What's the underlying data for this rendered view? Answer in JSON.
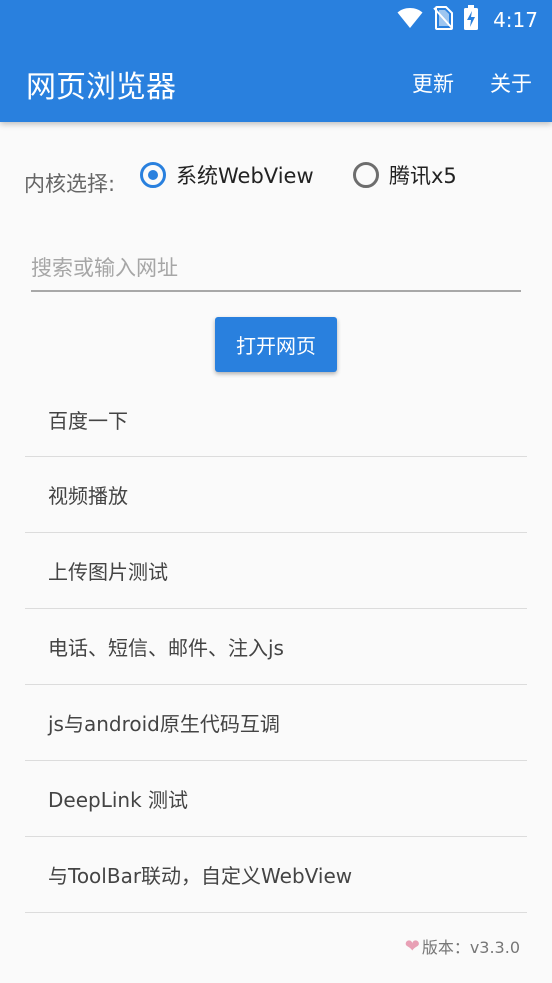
{
  "status_bar": {
    "time": "4:17",
    "icons": [
      "wifi-icon",
      "no-sim-icon",
      "battery-charging-icon"
    ]
  },
  "toolbar": {
    "title": "网页浏览器",
    "update_label": "更新",
    "about_label": "关于"
  },
  "kernel": {
    "label": "内核选择:",
    "options": [
      {
        "label": "系统WebView",
        "selected": true
      },
      {
        "label": "腾讯x5",
        "selected": false
      }
    ]
  },
  "search": {
    "placeholder": "搜索或输入网址",
    "value": ""
  },
  "open_button_label": "打开网页",
  "menu": {
    "items": [
      "百度一下",
      "视频播放",
      "上传图片测试",
      "电话、短信、邮件、注入js",
      "js与android原生代码互调",
      "DeepLink 测试",
      "与ToolBar联动，自定义WebView"
    ]
  },
  "footer": {
    "version_text": "版本：v3.3.0"
  },
  "colors": {
    "primary": "#2980de",
    "heart": "#e8a0b5"
  }
}
